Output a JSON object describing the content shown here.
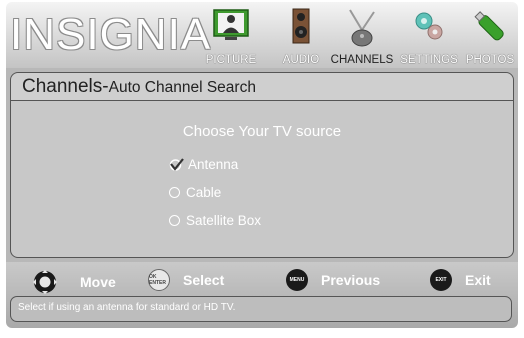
{
  "brand": "INSIGNIA",
  "menu": [
    {
      "label": "PICTURE",
      "icon": "tv-picture-icon"
    },
    {
      "label": "AUDIO",
      "icon": "speaker-icon"
    },
    {
      "label": "CHANNELS",
      "icon": "antenna-icon"
    },
    {
      "label": "SETTINGS",
      "icon": "gears-icon"
    },
    {
      "label": "PHOTOS",
      "icon": "usb-stick-icon"
    }
  ],
  "active_menu": "CHANNELS",
  "page": {
    "title": "Channels-",
    "subtitle": "Auto Channel Search"
  },
  "prompt": "Choose Your TV source",
  "options": [
    {
      "label": "Antenna",
      "selected": true
    },
    {
      "label": "Cable",
      "selected": false
    },
    {
      "label": "Satellite Box",
      "selected": false
    }
  ],
  "controls": [
    {
      "label": "Move",
      "icon": "dpad-icon"
    },
    {
      "label": "Select",
      "icon": "ok-enter-icon",
      "icon_text": "OK ENTER"
    },
    {
      "label": "Previous",
      "icon": "menu-button-icon",
      "icon_text": "MENU"
    },
    {
      "label": "Exit",
      "icon": "exit-button-icon",
      "icon_text": "EXIT"
    }
  ],
  "help_text": "Select if using an antenna for standard or HD TV.",
  "colors": {
    "panel": "#c8c8c8",
    "accent_green": "#3aa02b",
    "text": "#ffffff"
  }
}
